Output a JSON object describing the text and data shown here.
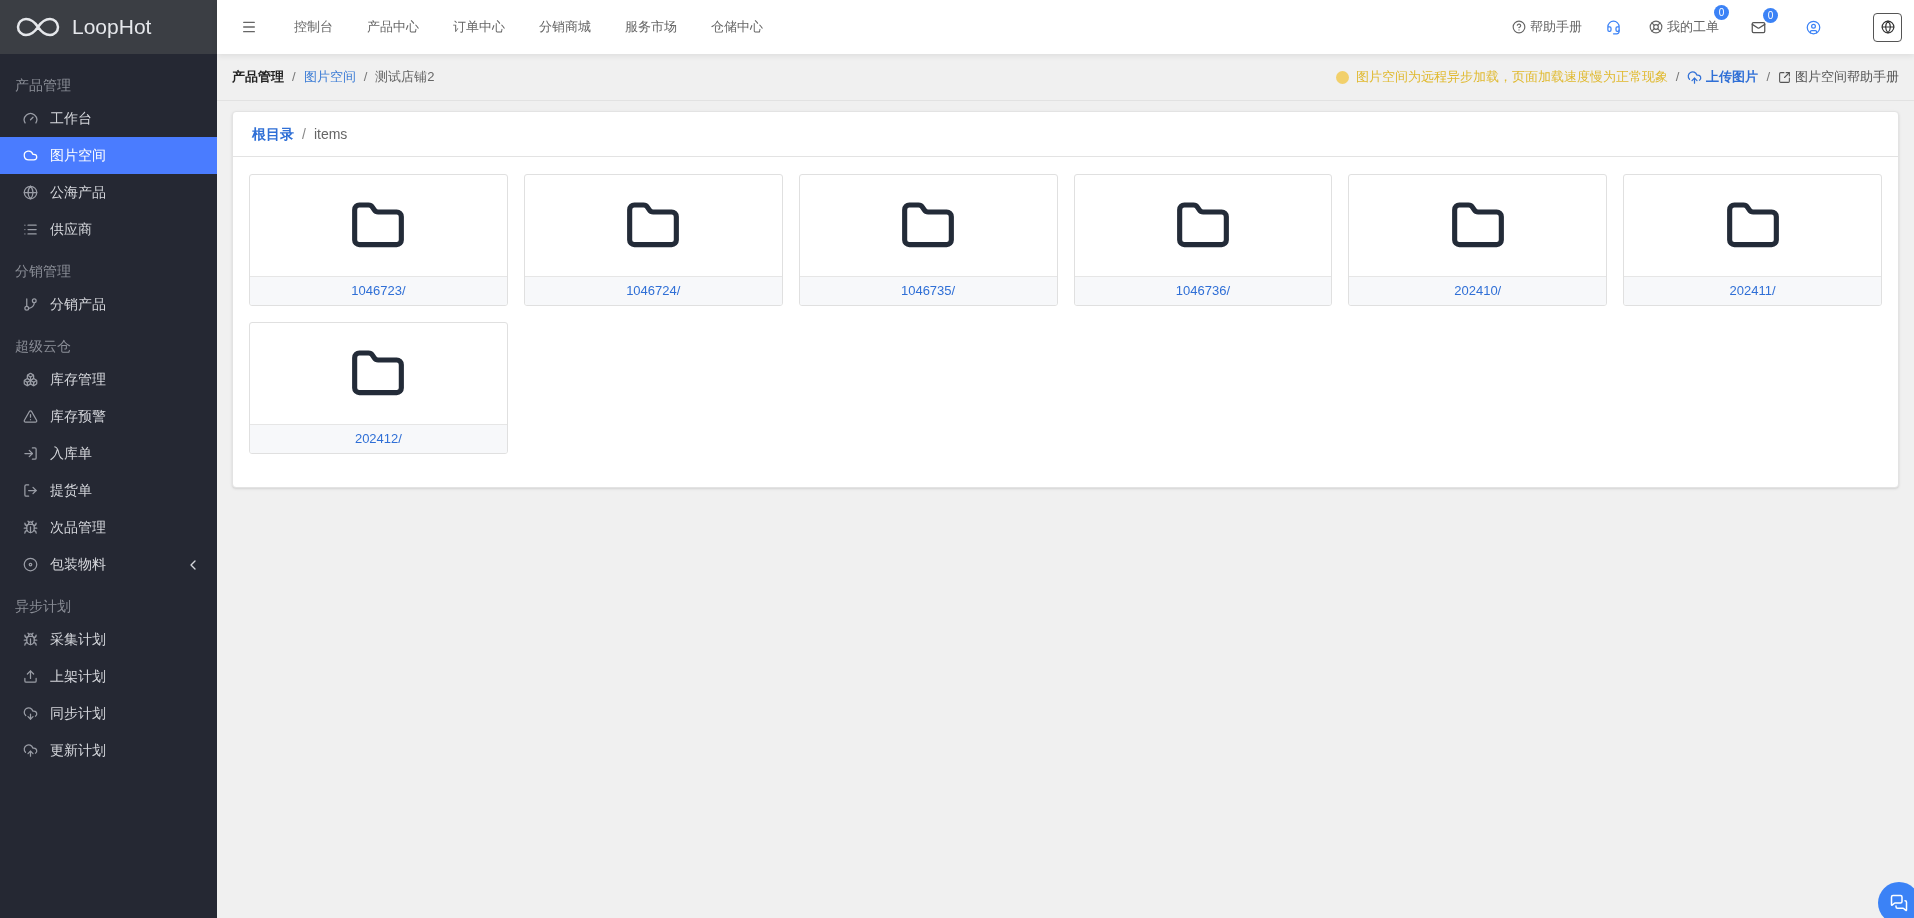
{
  "logo": {
    "text": "LoopHot"
  },
  "sidebar": {
    "sections": [
      {
        "title": "产品管理",
        "items": [
          {
            "label": "工作台",
            "selected": false
          },
          {
            "label": "图片空间",
            "selected": true
          },
          {
            "label": "公海产品",
            "selected": false
          },
          {
            "label": "供应商",
            "selected": false
          }
        ]
      },
      {
        "title": "分销管理",
        "items": [
          {
            "label": "分销产品",
            "selected": false
          }
        ]
      },
      {
        "title": "超级云仓",
        "items": [
          {
            "label": "库存管理",
            "selected": false
          },
          {
            "label": "库存预警",
            "selected": false
          },
          {
            "label": "入库单",
            "selected": false
          },
          {
            "label": "提货单",
            "selected": false
          },
          {
            "label": "次品管理",
            "selected": false
          },
          {
            "label": "包装物料",
            "selected": false,
            "expanded": false
          }
        ]
      },
      {
        "title": "异步计划",
        "items": [
          {
            "label": "采集计划",
            "selected": false
          },
          {
            "label": "上架计划",
            "selected": false
          },
          {
            "label": "同步计划",
            "selected": false
          },
          {
            "label": "更新计划",
            "selected": false
          }
        ]
      }
    ]
  },
  "topnav": {
    "links": [
      "控制台",
      "产品中心",
      "订单中心",
      "分销商城",
      "服务市场",
      "仓储中心"
    ],
    "help": "帮助手册",
    "tickets": {
      "label": "我的工单",
      "badge": "0"
    },
    "messages": {
      "badge": "0"
    }
  },
  "breadcrumb": {
    "items": [
      "产品管理",
      "图片空间",
      "测试店铺2"
    ],
    "notice": "图片空间为远程异步加载，页面加载速度慢为正常现象",
    "upload": "上传图片",
    "help": "图片空间帮助手册"
  },
  "separator": "/",
  "folder_path": [
    "根目录",
    "items"
  ],
  "folders": [
    "1046723/",
    "1046724/",
    "1046735/",
    "1046736/",
    "202410/",
    "202411/",
    "202412/"
  ]
}
